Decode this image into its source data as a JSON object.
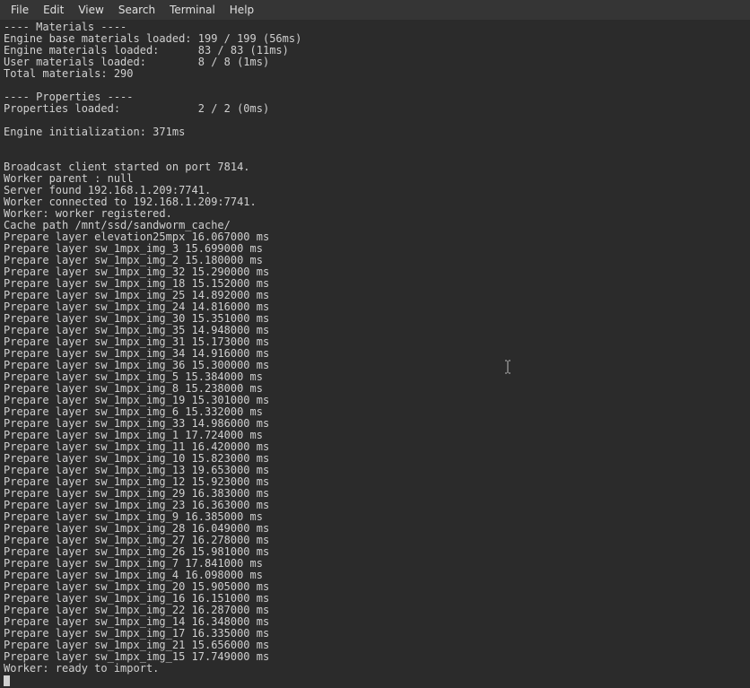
{
  "menubar": {
    "file": "File",
    "edit": "Edit",
    "view": "View",
    "search": "Search",
    "terminal": "Terminal",
    "help": "Help"
  },
  "lines": [
    "---- Materials ----",
    "Engine base materials loaded: 199 / 199 (56ms)",
    "Engine materials loaded:      83 / 83 (11ms)",
    "User materials loaded:        8 / 8 (1ms)",
    "Total materials: 290",
    "",
    "---- Properties ----",
    "Properties loaded:            2 / 2 (0ms)",
    "",
    "Engine initialization: 371ms",
    "",
    "",
    "Broadcast client started on port 7814.",
    "Worker parent : null",
    "Server found 192.168.1.209:7741.",
    "Worker connected to 192.168.1.209:7741.",
    "Worker: worker registered.",
    "Cache path /mnt/ssd/sandworm_cache/",
    "Prepare layer elevation25mpx 16.067000 ms",
    "Prepare layer sw_1mpx_img_3 15.699000 ms",
    "Prepare layer sw_1mpx_img_2 15.180000 ms",
    "Prepare layer sw_1mpx_img_32 15.290000 ms",
    "Prepare layer sw_1mpx_img_18 15.152000 ms",
    "Prepare layer sw_1mpx_img_25 14.892000 ms",
    "Prepare layer sw_1mpx_img_24 14.816000 ms",
    "Prepare layer sw_1mpx_img_30 15.351000 ms",
    "Prepare layer sw_1mpx_img_35 14.948000 ms",
    "Prepare layer sw_1mpx_img_31 15.173000 ms",
    "Prepare layer sw_1mpx_img_34 14.916000 ms",
    "Prepare layer sw_1mpx_img_36 15.300000 ms",
    "Prepare layer sw_1mpx_img_5 15.384000 ms",
    "Prepare layer sw_1mpx_img_8 15.238000 ms",
    "Prepare layer sw_1mpx_img_19 15.301000 ms",
    "Prepare layer sw_1mpx_img_6 15.332000 ms",
    "Prepare layer sw_1mpx_img_33 14.986000 ms",
    "Prepare layer sw_1mpx_img_1 17.724000 ms",
    "Prepare layer sw_1mpx_img_11 16.420000 ms",
    "Prepare layer sw_1mpx_img_10 15.823000 ms",
    "Prepare layer sw_1mpx_img_13 19.653000 ms",
    "Prepare layer sw_1mpx_img_12 15.923000 ms",
    "Prepare layer sw_1mpx_img_29 16.383000 ms",
    "Prepare layer sw_1mpx_img_23 16.363000 ms",
    "Prepare layer sw_1mpx_img_9 16.385000 ms",
    "Prepare layer sw_1mpx_img_28 16.049000 ms",
    "Prepare layer sw_1mpx_img_27 16.278000 ms",
    "Prepare layer sw_1mpx_img_26 15.981000 ms",
    "Prepare layer sw_1mpx_img_7 17.841000 ms",
    "Prepare layer sw_1mpx_img_4 16.098000 ms",
    "Prepare layer sw_1mpx_img_20 15.905000 ms",
    "Prepare layer sw_1mpx_img_16 16.151000 ms",
    "Prepare layer sw_1mpx_img_22 16.287000 ms",
    "Prepare layer sw_1mpx_img_14 16.348000 ms",
    "Prepare layer sw_1mpx_img_17 16.335000 ms",
    "Prepare layer sw_1mpx_img_21 15.656000 ms",
    "Prepare layer sw_1mpx_img_15 17.749000 ms",
    "Worker: ready to import."
  ]
}
